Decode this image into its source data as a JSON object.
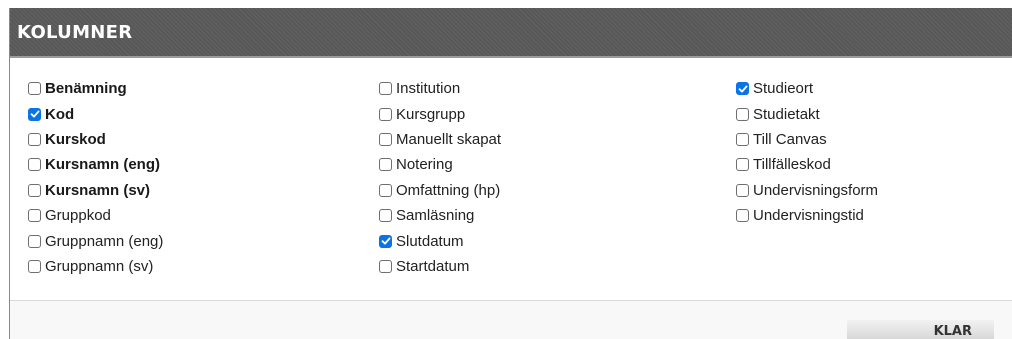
{
  "dialog": {
    "title": "KOLUMNER",
    "done_label": "KLAR"
  },
  "columns": [
    {
      "options": [
        {
          "label": "Benämning",
          "checked": false,
          "bold": true
        },
        {
          "label": "Kod",
          "checked": true,
          "bold": true
        },
        {
          "label": "Kurskod",
          "checked": false,
          "bold": true
        },
        {
          "label": "Kursnamn (eng)",
          "checked": false,
          "bold": true
        },
        {
          "label": "Kursnamn (sv)",
          "checked": false,
          "bold": true
        },
        {
          "label": "Gruppkod",
          "checked": false,
          "bold": false
        },
        {
          "label": "Gruppnamn (eng)",
          "checked": false,
          "bold": false
        },
        {
          "label": "Gruppnamn (sv)",
          "checked": false,
          "bold": false
        }
      ]
    },
    {
      "options": [
        {
          "label": "Institution",
          "checked": false,
          "bold": false
        },
        {
          "label": "Kursgrupp",
          "checked": false,
          "bold": false
        },
        {
          "label": "Manuellt skapat",
          "checked": false,
          "bold": false
        },
        {
          "label": "Notering",
          "checked": false,
          "bold": false
        },
        {
          "label": "Omfattning (hp)",
          "checked": false,
          "bold": false
        },
        {
          "label": "Samläsning",
          "checked": false,
          "bold": false
        },
        {
          "label": "Slutdatum",
          "checked": true,
          "bold": false
        },
        {
          "label": "Startdatum",
          "checked": false,
          "bold": false
        }
      ]
    },
    {
      "options": [
        {
          "label": "Studieort",
          "checked": true,
          "bold": false
        },
        {
          "label": "Studietakt",
          "checked": false,
          "bold": false
        },
        {
          "label": "Till Canvas",
          "checked": false,
          "bold": false
        },
        {
          "label": "Tillfälleskod",
          "checked": false,
          "bold": false
        },
        {
          "label": "Undervisningsform",
          "checked": false,
          "bold": false
        },
        {
          "label": "Undervisningstid",
          "checked": false,
          "bold": false
        }
      ]
    }
  ],
  "colors": {
    "checkbox_checked": "#0b73e8",
    "header_background": "#5e5e5e"
  },
  "icons": {
    "checked": "check-icon"
  }
}
